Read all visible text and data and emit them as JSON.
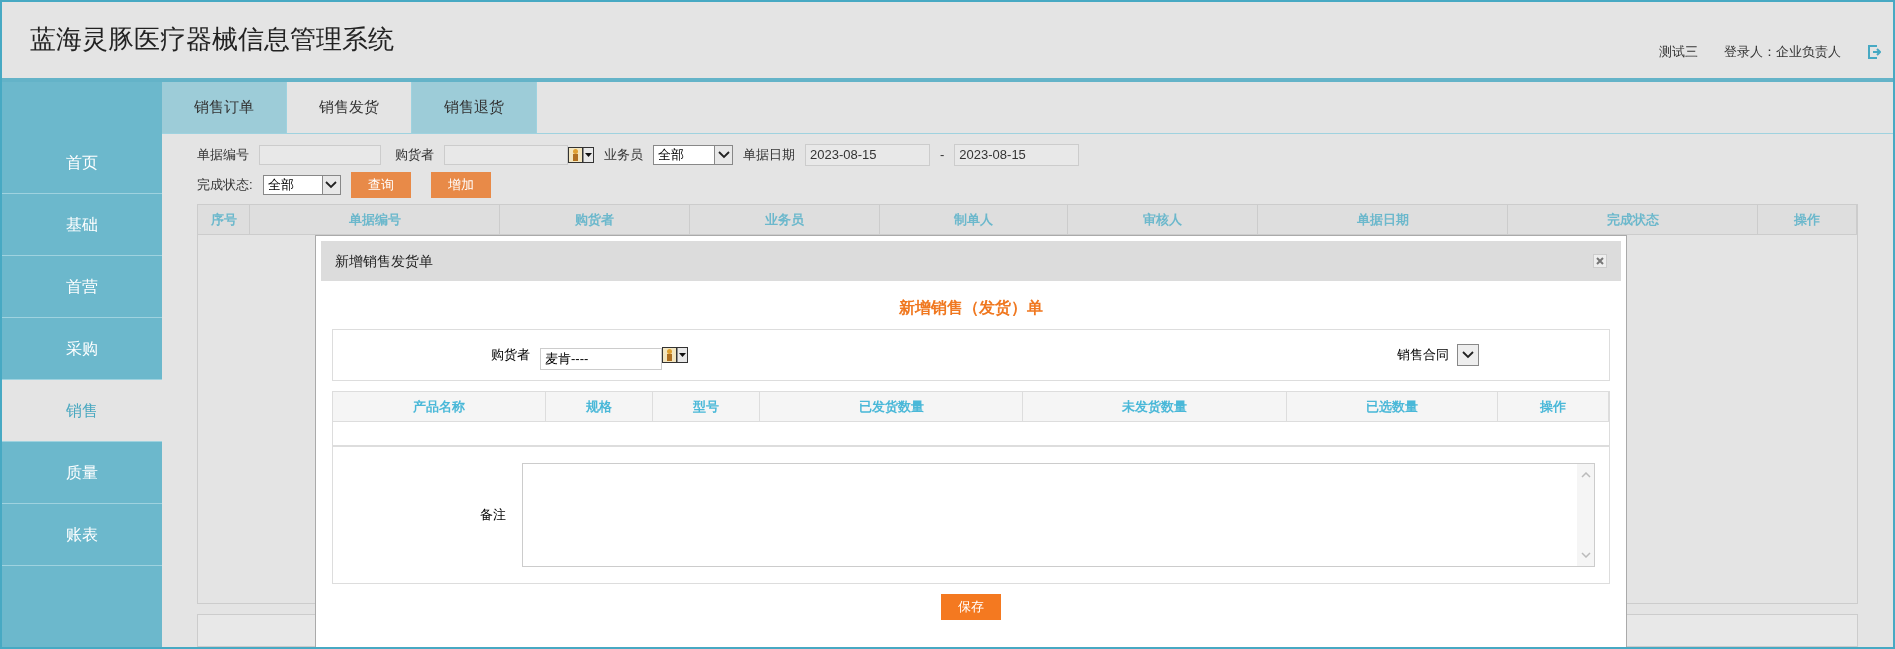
{
  "header": {
    "title": "蓝海灵豚医疗器械信息管理系统",
    "user_name": "测试三",
    "login_label": "登录人：企业负责人"
  },
  "sidebar": {
    "items": [
      {
        "label": "首页",
        "selected": false
      },
      {
        "label": "基础",
        "selected": false
      },
      {
        "label": "首营",
        "selected": false
      },
      {
        "label": "采购",
        "selected": false
      },
      {
        "label": "销售",
        "selected": true
      },
      {
        "label": "质量",
        "selected": false
      },
      {
        "label": "账表",
        "selected": false
      }
    ]
  },
  "tabs": [
    {
      "label": "销售订单",
      "selected": false
    },
    {
      "label": "销售发货",
      "selected": true
    },
    {
      "label": "销售退货",
      "selected": false
    }
  ],
  "filters": {
    "doc_no_label": "单据编号",
    "buyer_label": "购货者",
    "salesman_label": "业务员",
    "salesman_value": "全部",
    "date_label": "单据日期",
    "date_from": "2023-08-15",
    "date_sep": "-",
    "date_to": "2023-08-15",
    "status_label": "完成状态:",
    "status_value": "全部",
    "query_button": "查询",
    "add_button": "增加"
  },
  "table": {
    "columns": [
      "序号",
      "单据编号",
      "购货者",
      "业务员",
      "制单人",
      "审核人",
      "单据日期",
      "完成状态",
      "操作"
    ]
  },
  "dialog": {
    "title": "新增销售发货单",
    "heading": "新增销售（发货）单",
    "buyer_label": "购货者",
    "buyer_value": "麦肯----",
    "contract_label": "销售合同",
    "columns": [
      "产品名称",
      "规格",
      "型号",
      "已发货数量",
      "未发货数量",
      "已选数量",
      "操作"
    ],
    "remark_label": "备注",
    "save_button": "保存"
  }
}
